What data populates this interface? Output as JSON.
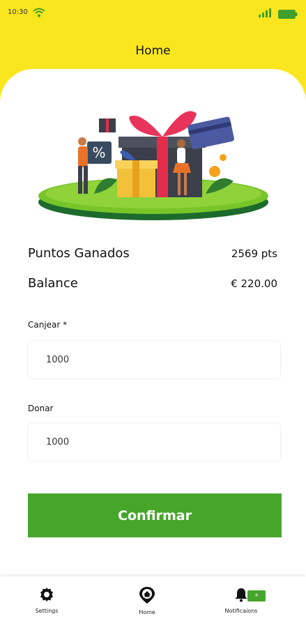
{
  "status_bar": {
    "time": "10:30",
    "icons": [
      "wifi-icon",
      "signal-icon",
      "battery-icon"
    ]
  },
  "header": {
    "title": "Home"
  },
  "summary": {
    "points_label": "Puntos Ganados",
    "points_value": "2569 pts",
    "balance_label": "Balance",
    "balance_value": "€ 220.00"
  },
  "form": {
    "canjear_label": "Canjear *",
    "canjear_value": "1000",
    "donar_label": "Donar",
    "donar_value": "1000",
    "confirm_label": "Confirmar"
  },
  "bottom_nav": {
    "items": [
      {
        "label": "Settings",
        "icon": "gear-icon"
      },
      {
        "label": "Home",
        "icon": "home-pin-icon"
      },
      {
        "label": "Notificaions",
        "icon": "bell-icon"
      }
    ],
    "badge": "+"
  },
  "colors": {
    "accent_yellow": "#f9e61f",
    "primary_green": "#46a62b"
  }
}
